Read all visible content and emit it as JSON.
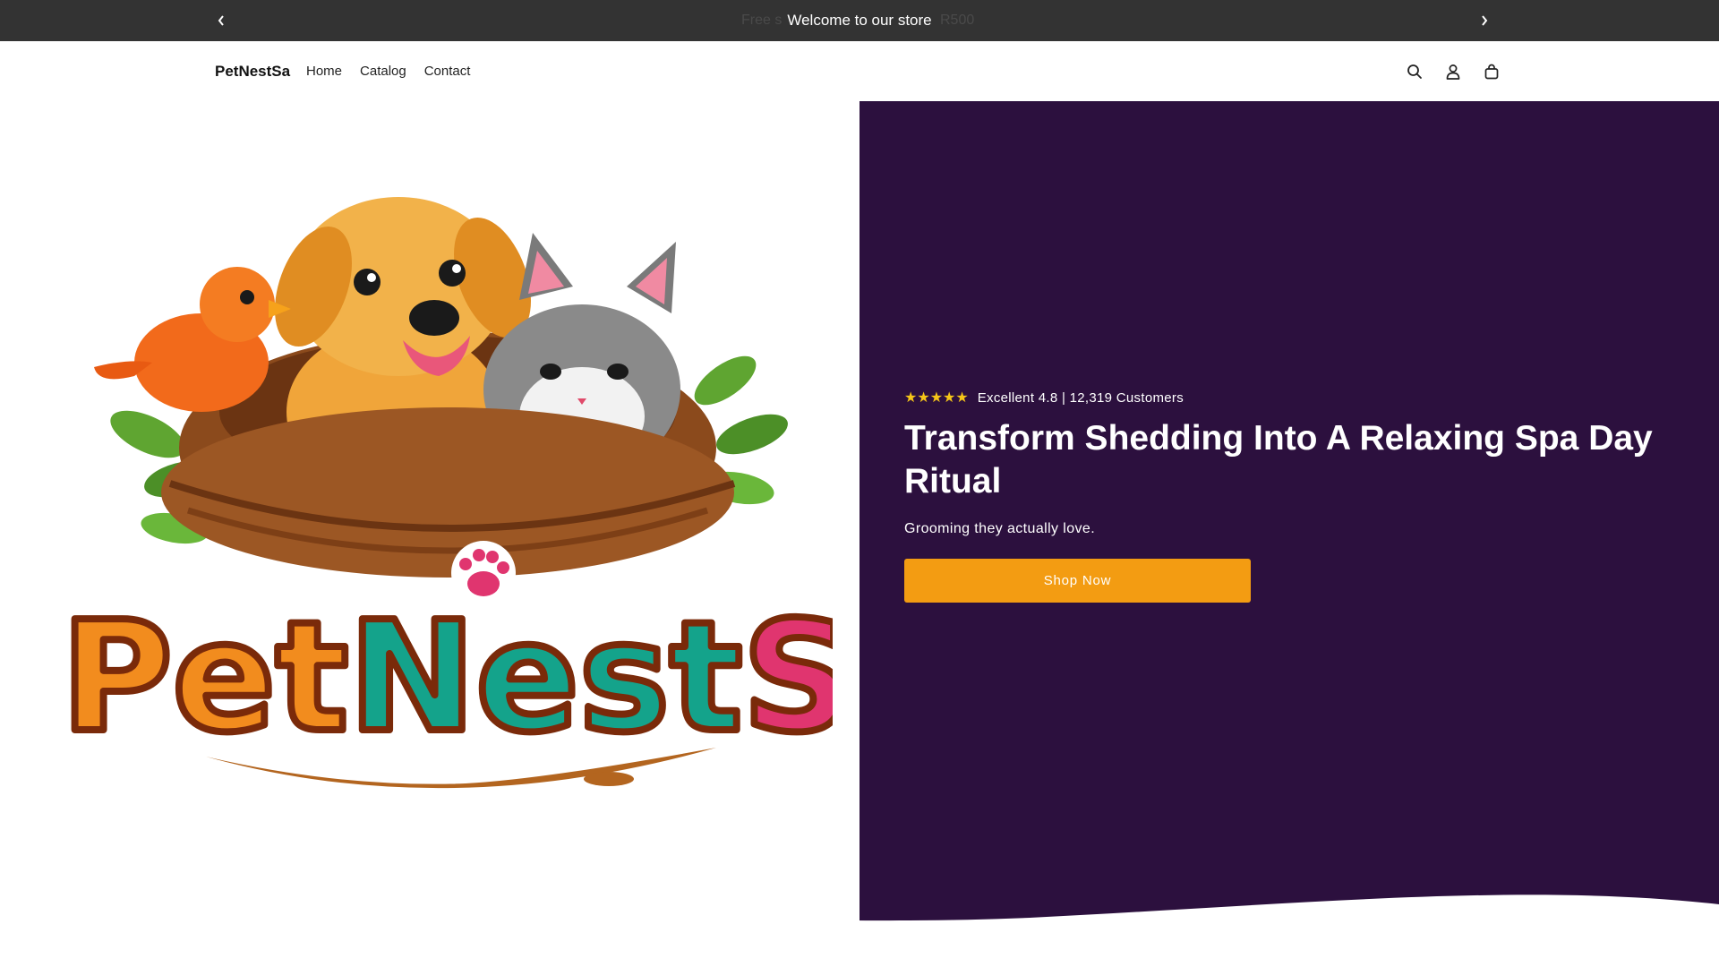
{
  "announcement": {
    "message": "Welcome to our store",
    "ghost_left": "Free s",
    "ghost_right": "R500",
    "prev_icon": "chevron-left-icon",
    "next_icon": "chevron-right-icon"
  },
  "header": {
    "brand": "PetNestSa",
    "nav": [
      "Home",
      "Catalog",
      "Contact"
    ],
    "icons": [
      "search-icon",
      "account-icon",
      "cart-icon"
    ]
  },
  "hero": {
    "logo_text": {
      "pet": "Pet",
      "nest": "Nest",
      "sa": "SA"
    },
    "rating_stars": "★★★★★",
    "rating_text": "Excellent 4.8 | 12,319 Customers",
    "headline": "Transform Shedding Into A Relaxing Spa Day Ritual",
    "subheadline": "Grooming they actually love.",
    "cta_label": "Shop Now",
    "rating_value": 4.8
  },
  "colors": {
    "announcement_bg": "#333333",
    "hero_panel_bg": "#2c103e",
    "cta_bg": "#f39c12",
    "star": "#f5c518",
    "logo_pet": "#f28c1e",
    "logo_nest": "#14a38b",
    "logo_sa": "#e0356f"
  }
}
